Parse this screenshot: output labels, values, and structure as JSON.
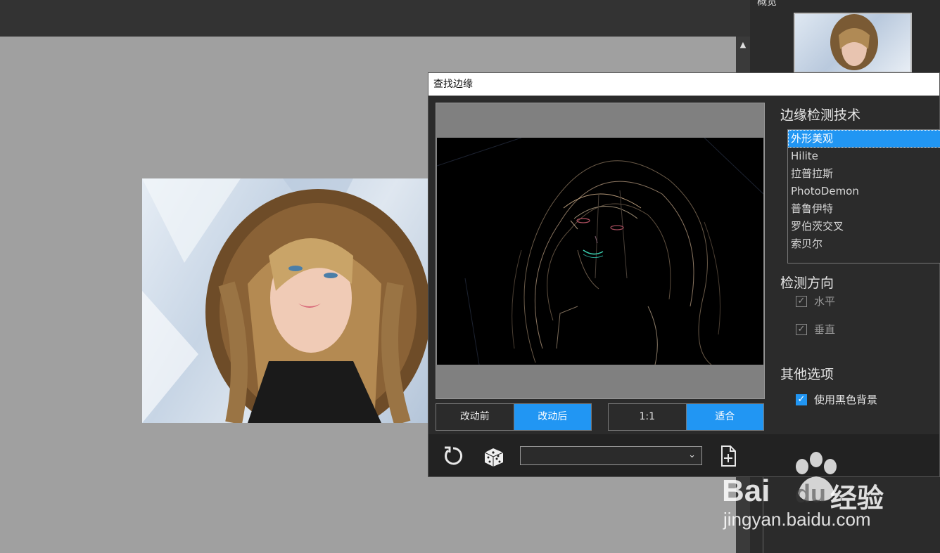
{
  "app": {
    "overview_label": "概览"
  },
  "dialog": {
    "title": "查找边缘",
    "view_toggle": {
      "before": "改动前",
      "after": "改动后",
      "active": "after"
    },
    "zoom_toggle": {
      "one_to_one": "1:1",
      "fit": "适合",
      "active": "fit"
    },
    "technique": {
      "title": "边缘检测技术",
      "items": [
        "外形美观",
        "Hilite",
        "拉普拉斯",
        "PhotoDemon",
        "普鲁伊特",
        "罗伯茨交叉",
        "索贝尔"
      ],
      "selected_index": 0
    },
    "direction": {
      "title": "检测方向",
      "horizontal": "水平",
      "vertical": "垂直",
      "horizontal_checked": true,
      "vertical_checked": true
    },
    "other": {
      "title": "其他选项",
      "black_background": "使用黑色背景",
      "black_background_checked": true
    },
    "preset_combo_value": "",
    "icons": {
      "reset": "reset-icon",
      "randomize": "dice-icon",
      "add_preset": "add-file-icon"
    }
  },
  "watermark": {
    "brand": "Bai",
    "brand2": "du",
    "product": "经验",
    "url": "jingyan.baidu.com"
  },
  "colors": {
    "accent": "#2196f3",
    "panel": "#2b2b2b",
    "canvas": "#a0a0a0"
  }
}
